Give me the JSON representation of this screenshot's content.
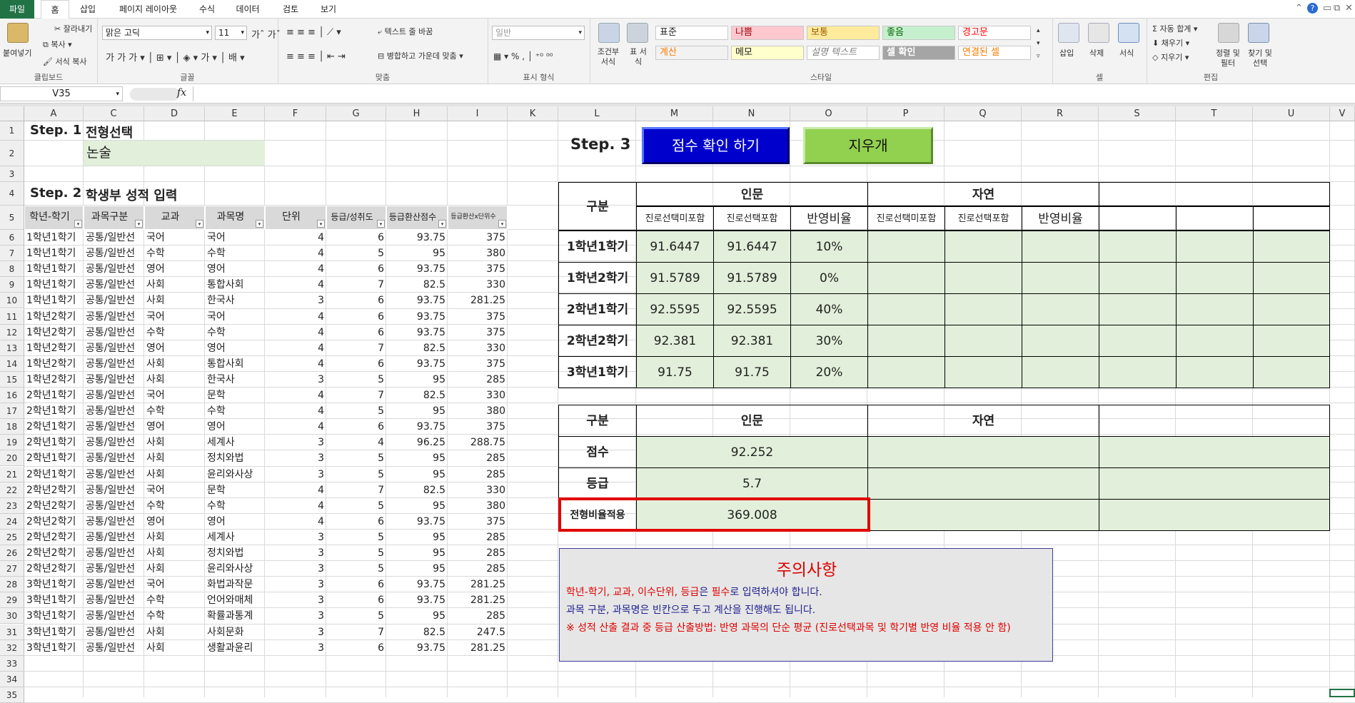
{
  "ribbon": {
    "tabs": [
      "파일",
      "홈",
      "삽입",
      "페이지 레이아웃",
      "수식",
      "데이터",
      "검토",
      "보기"
    ],
    "clipboard": {
      "paste": "붙여넣기",
      "cut": "잘라내기",
      "copy": "복사",
      "format_painter": "서식 복사",
      "label": "클립보드"
    },
    "font": {
      "name": "맑은 고딕",
      "size": "11",
      "label": "글꼴"
    },
    "align": {
      "wrap": "텍스트 줄 바꿈",
      "merge": "병합하고 가운데 맞춤",
      "label": "맞춤"
    },
    "number": {
      "format": "일반",
      "label": "표시 형식"
    },
    "styles": {
      "conditional": "조건부 서식",
      "table": "표 서식",
      "label": "스타일",
      "row1": [
        "표준",
        "나쁨",
        "보통",
        "좋음",
        "경고문"
      ],
      "row2": [
        "계산",
        "메모",
        "설명 텍스트",
        "셀 확인",
        "연결된 셀"
      ]
    },
    "cells": {
      "insert": "삽입",
      "delete": "삭제",
      "format": "서식",
      "label": "셀"
    },
    "editing": {
      "autosum": "자동 합계",
      "fill": "채우기",
      "clear": "지우기",
      "sort": "정렬 및 필터",
      "find": "찾기 및 선택",
      "label": "편집"
    },
    "colors": {
      "file_tab": "#217346",
      "header_gray": "#d9d9d9",
      "green_fill": "#e2efda",
      "blue_button": "#0000cc",
      "red_text": "#e00000",
      "dark_blue_text": "#1f1f8f"
    }
  },
  "formula_bar": {
    "name_box": "V35",
    "fx": "fx"
  },
  "columns": [
    "A",
    "C",
    "D",
    "E",
    "F",
    "G",
    "H",
    "I",
    "K",
    "L",
    "M",
    "N",
    "O",
    "P",
    "Q",
    "R",
    "S",
    "T",
    "U",
    "V"
  ],
  "rows": [
    "1",
    "2",
    "3",
    "4",
    "5",
    "6",
    "7",
    "8",
    "9",
    "10",
    "11",
    "12",
    "13",
    "14",
    "15",
    "16",
    "17",
    "18",
    "19",
    "20",
    "21",
    "22",
    "23",
    "24",
    "25",
    "26",
    "27",
    "28",
    "29",
    "30",
    "31",
    "32",
    "33",
    "34",
    "35"
  ],
  "step1": {
    "label": "Step. 1",
    "title": "전형선택",
    "value": "논술"
  },
  "step2": {
    "label": "Step. 2",
    "title": "학생부 성적 입력"
  },
  "step3": {
    "label": "Step. 3",
    "check_button": "점수 확인 하기",
    "erase_button": "지우개"
  },
  "grades_table": {
    "headers": [
      "학년-학기",
      "과목구분",
      "교과",
      "과목명",
      "단위",
      "등급/성취도",
      "등급환산점수",
      "등급환산x단위수"
    ],
    "rows": [
      [
        "1학년1학기",
        "공통/일반선",
        "국어",
        "국어",
        "4",
        "6",
        "93.75",
        "375"
      ],
      [
        "1학년1학기",
        "공통/일반선",
        "수학",
        "수학",
        "4",
        "5",
        "95",
        "380"
      ],
      [
        "1학년1학기",
        "공통/일반선",
        "영어",
        "영어",
        "4",
        "6",
        "93.75",
        "375"
      ],
      [
        "1학년1학기",
        "공통/일반선",
        "사회",
        "통합사회",
        "4",
        "7",
        "82.5",
        "330"
      ],
      [
        "1학년1학기",
        "공통/일반선",
        "사회",
        "한국사",
        "3",
        "6",
        "93.75",
        "281.25"
      ],
      [
        "1학년2학기",
        "공통/일반선",
        "국어",
        "국어",
        "4",
        "6",
        "93.75",
        "375"
      ],
      [
        "1학년2학기",
        "공통/일반선",
        "수학",
        "수학",
        "4",
        "6",
        "93.75",
        "375"
      ],
      [
        "1학년2학기",
        "공통/일반선",
        "영어",
        "영어",
        "4",
        "7",
        "82.5",
        "330"
      ],
      [
        "1학년2학기",
        "공통/일반선",
        "사회",
        "통합사회",
        "4",
        "6",
        "93.75",
        "375"
      ],
      [
        "1학년2학기",
        "공통/일반선",
        "사회",
        "한국사",
        "3",
        "5",
        "95",
        "285"
      ],
      [
        "2학년1학기",
        "공통/일반선",
        "국어",
        "문학",
        "4",
        "7",
        "82.5",
        "330"
      ],
      [
        "2학년1학기",
        "공통/일반선",
        "수학",
        "수학",
        "4",
        "5",
        "95",
        "380"
      ],
      [
        "2학년1학기",
        "공통/일반선",
        "영어",
        "영어",
        "4",
        "6",
        "93.75",
        "375"
      ],
      [
        "2학년1학기",
        "공통/일반선",
        "사회",
        "세계사",
        "3",
        "4",
        "96.25",
        "288.75"
      ],
      [
        "2학년1학기",
        "공통/일반선",
        "사회",
        "정치와법",
        "3",
        "5",
        "95",
        "285"
      ],
      [
        "2학년1학기",
        "공통/일반선",
        "사회",
        "윤리와사상",
        "3",
        "5",
        "95",
        "285"
      ],
      [
        "2학년2학기",
        "공통/일반선",
        "국어",
        "문학",
        "4",
        "7",
        "82.5",
        "330"
      ],
      [
        "2학년2학기",
        "공통/일반선",
        "수학",
        "수학",
        "4",
        "5",
        "95",
        "380"
      ],
      [
        "2학년2학기",
        "공통/일반선",
        "영어",
        "영어",
        "4",
        "6",
        "93.75",
        "375"
      ],
      [
        "2학년2학기",
        "공통/일반선",
        "사회",
        "세계사",
        "3",
        "5",
        "95",
        "285"
      ],
      [
        "2학년2학기",
        "공통/일반선",
        "사회",
        "정치와법",
        "3",
        "5",
        "95",
        "285"
      ],
      [
        "2학년2학기",
        "공통/일반선",
        "사회",
        "윤리와사상",
        "3",
        "5",
        "95",
        "285"
      ],
      [
        "3학년1학기",
        "공통/일반선",
        "국어",
        "화법과작문",
        "3",
        "6",
        "93.75",
        "281.25"
      ],
      [
        "3학년1학기",
        "공통/일반선",
        "수학",
        "언어와매체",
        "3",
        "6",
        "93.75",
        "281.25"
      ],
      [
        "3학년1학기",
        "공통/일반선",
        "수학",
        "확률과통계",
        "3",
        "5",
        "95",
        "285"
      ],
      [
        "3학년1학기",
        "공통/일반선",
        "사회",
        "사회문화",
        "3",
        "7",
        "82.5",
        "247.5"
      ],
      [
        "3학년1학기",
        "공통/일반선",
        "사회",
        "생활과윤리",
        "3",
        "6",
        "93.75",
        "281.25"
      ]
    ]
  },
  "semester_table": {
    "corner": "구분",
    "groups": [
      "인문",
      "자연"
    ],
    "subheaders": [
      "진로선택미포함",
      "진로선택포함",
      "반영비율",
      "진로선택미포함",
      "진로선택포함",
      "반영비율"
    ],
    "rows": [
      {
        "label": "1학년1학기",
        "values": [
          "91.6447",
          "91.6447",
          "10%"
        ]
      },
      {
        "label": "1학년2학기",
        "values": [
          "91.5789",
          "91.5789",
          "0%"
        ]
      },
      {
        "label": "2학년1학기",
        "values": [
          "92.5595",
          "92.5595",
          "40%"
        ]
      },
      {
        "label": "2학년2학기",
        "values": [
          "92.381",
          "92.381",
          "30%"
        ]
      },
      {
        "label": "3학년1학기",
        "values": [
          "91.75",
          "91.75",
          "20%"
        ]
      }
    ]
  },
  "result_table": {
    "corner": "구분",
    "groups": [
      "인문",
      "자연"
    ],
    "rows": [
      {
        "label": "점수",
        "value": "92.252"
      },
      {
        "label": "등급",
        "value": "5.7"
      },
      {
        "label": "전형비율적용",
        "value": "369.008"
      }
    ]
  },
  "notice": {
    "title": "주의사항",
    "line1_parts": [
      "학년-학기, 교과, 이수단위, 등급",
      "은 ",
      "필수",
      "로 입력하셔야 합니다."
    ],
    "line2": "과목 구분, 과목명은 빈칸으로 두고 계산을 진행해도 됩니다.",
    "line3": "※ 성적 산출 결과 중 등급 산출방법: 반영 과목의 단순 평균 (진로선택과목 및 학기별 반영 비율 적용 안 함)"
  }
}
